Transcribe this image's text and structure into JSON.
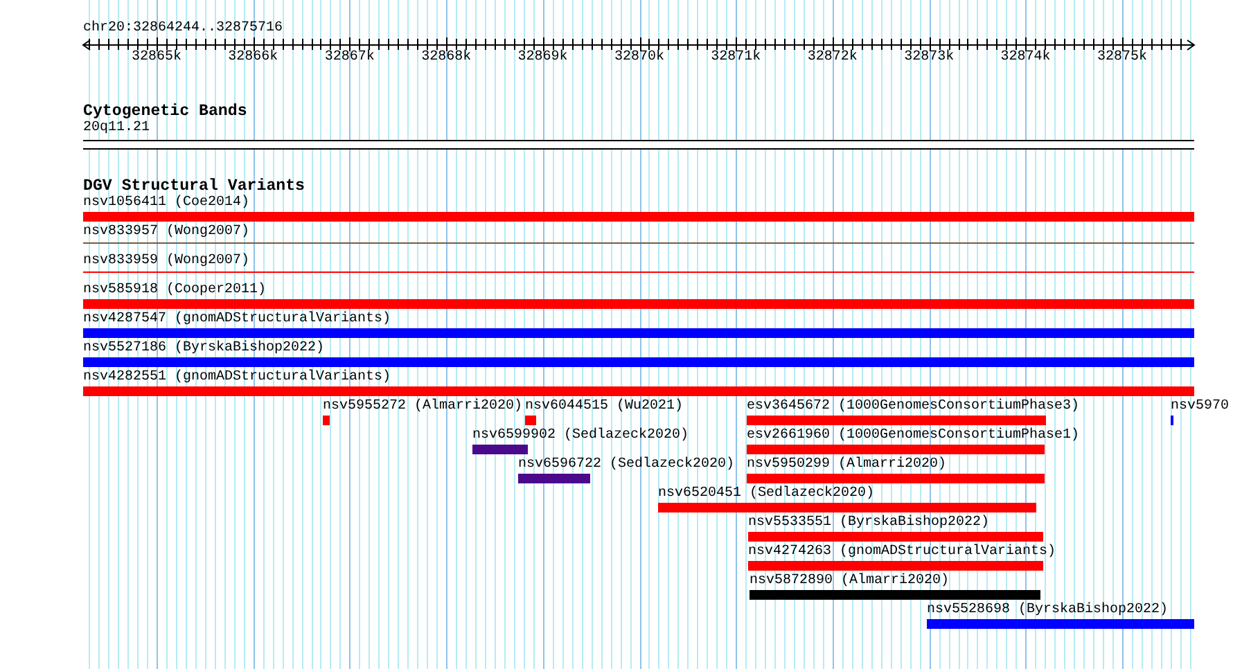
{
  "ruler": {
    "location": "chr20:32864244..32875716",
    "ticks": [
      "32865k",
      "32866k",
      "32867k",
      "32868k",
      "32869k",
      "32870k",
      "32871k",
      "32872k",
      "32873k",
      "32874k",
      "32875k"
    ]
  },
  "tracks": [
    {
      "title": "Cytogenetic Bands",
      "kind": "bands",
      "features": [
        {
          "label": "20q11.21"
        }
      ]
    },
    {
      "title": "DGV Structural Variants",
      "kind": "variants",
      "features": [
        {
          "label": "nsv1056411 (Coe2014)",
          "color": "#ff0000",
          "kind": "thick"
        },
        {
          "label": "nsv833957 (Wong2007)",
          "color": "#7a5a3a",
          "kind": "thin"
        },
        {
          "label": "nsv833959 (Wong2007)",
          "color": "#ff0000",
          "kind": "thin"
        },
        {
          "label": "nsv585918 (Cooper2011)",
          "color": "#ff0000",
          "kind": "thick"
        },
        {
          "label": "nsv4287547 (gnomADStructuralVariants)",
          "color": "#0000ff",
          "kind": "thick"
        },
        {
          "label": "nsv5527186 (ByrskaBishop2022)",
          "color": "#0000ff",
          "kind": "thick"
        },
        {
          "label": "nsv4282551 (gnomADStructuralVariants)",
          "color": "#ff0000",
          "kind": "thick"
        },
        {
          "label": "nsv5955272 (Almarri2020)",
          "color": "#ff0000",
          "kind": "thick"
        },
        {
          "label": "nsv6044515 (Wu2021)",
          "color": "#ff0000",
          "kind": "thick"
        },
        {
          "label": "esv3645672 (1000GenomesConsortiumPhase3)",
          "color": "#ff0000",
          "kind": "thick"
        },
        {
          "label": "nsv5970",
          "color": "#0000ff",
          "kind": "thick"
        },
        {
          "label": "nsv6599902 (Sedlazeck2020)",
          "color": "#4b0a8c",
          "kind": "thick"
        },
        {
          "label": "esv2661960 (1000GenomesConsortiumPhase1)",
          "color": "#ff0000",
          "kind": "thick"
        },
        {
          "label": "nsv6596722 (Sedlazeck2020)",
          "color": "#4b0a8c",
          "kind": "thick"
        },
        {
          "label": "nsv5950299 (Almarri2020)",
          "color": "#ff0000",
          "kind": "thick"
        },
        {
          "label": "nsv6520451 (Sedlazeck2020)",
          "color": "#ff0000",
          "kind": "thick"
        },
        {
          "label": "nsv5533551 (ByrskaBishop2022)",
          "color": "#ff0000",
          "kind": "thick"
        },
        {
          "label": "nsv4274263 (gnomADStructuralVariants)",
          "color": "#ff0000",
          "kind": "thick"
        },
        {
          "label": "nsv5872890 (Almarri2020)",
          "color": "#000000",
          "kind": "thick"
        },
        {
          "label": "nsv5528698 (ByrskaBishop2022)",
          "color": "#0000ff",
          "kind": "thick"
        }
      ]
    }
  ]
}
